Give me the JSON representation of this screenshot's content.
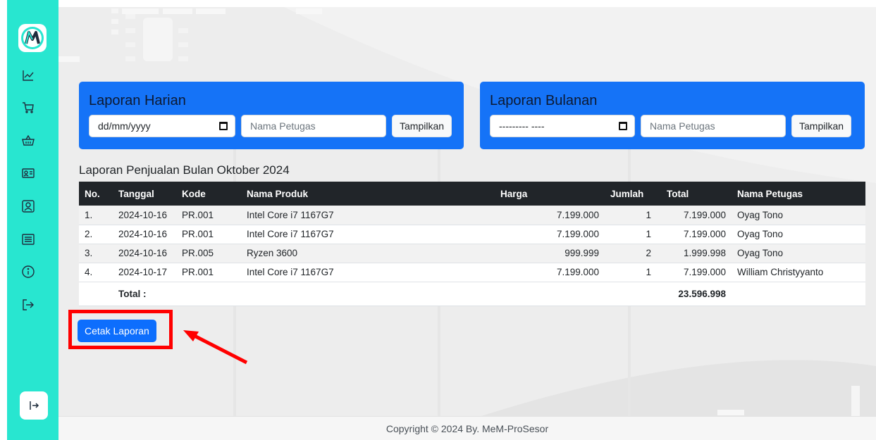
{
  "sidebar": {
    "logo_letter": "M",
    "icons": [
      "chart-line-icon",
      "cart-icon",
      "basket-icon",
      "id-card-icon",
      "user-square-icon",
      "list-icon",
      "info-icon",
      "logout-icon"
    ],
    "expand_icon": "expand-arrow-icon"
  },
  "harian": {
    "title": "Laporan Harian",
    "date_value": "dd/mm/yyyy",
    "petugas_placeholder": "Nama Petugas",
    "button_label": "Tampilkan"
  },
  "bulanan": {
    "title": "Laporan Bulanan",
    "month_value": "--------- ----",
    "petugas_placeholder": "Nama Petugas",
    "button_label": "Tampilkan"
  },
  "report": {
    "title": "Laporan Penjualan Bulan Oktober 2024",
    "headers": [
      "No.",
      "Tanggal",
      "Kode",
      "Nama Produk",
      "Harga",
      "Jumlah",
      "Total",
      "Nama Petugas"
    ],
    "rows": [
      {
        "no": "1.",
        "tanggal": "2024-10-16",
        "kode": "PR.001",
        "produk": "Intel Core i7 1167G7",
        "harga": "7.199.000",
        "jumlah": "1",
        "total": "7.199.000",
        "petugas": "Oyag Tono"
      },
      {
        "no": "2.",
        "tanggal": "2024-10-16",
        "kode": "PR.001",
        "produk": "Intel Core i7 1167G7",
        "harga": "7.199.000",
        "jumlah": "1",
        "total": "7.199.000",
        "petugas": "Oyag Tono"
      },
      {
        "no": "3.",
        "tanggal": "2024-10-16",
        "kode": "PR.005",
        "produk": "Ryzen 3600",
        "harga": "999.999",
        "jumlah": "2",
        "total": "1.999.998",
        "petugas": "Oyag Tono"
      },
      {
        "no": "4.",
        "tanggal": "2024-10-17",
        "kode": "PR.001",
        "produk": "Intel Core i7 1167G7",
        "harga": "7.199.000",
        "jumlah": "1",
        "total": "7.199.000",
        "petugas": "William Christyyanto"
      }
    ],
    "total_label": "Total :",
    "grand_total": "23.596.998",
    "print_button": "Cetak Laporan"
  },
  "footer": {
    "text": "Copyright © 2024 By. MeM-ProSesor"
  },
  "colors": {
    "sidebar": "#28e6d0",
    "panel": "#1573f7",
    "primary_button": "#0d6efd",
    "table_header": "#212529",
    "annotation": "#ff0000"
  }
}
